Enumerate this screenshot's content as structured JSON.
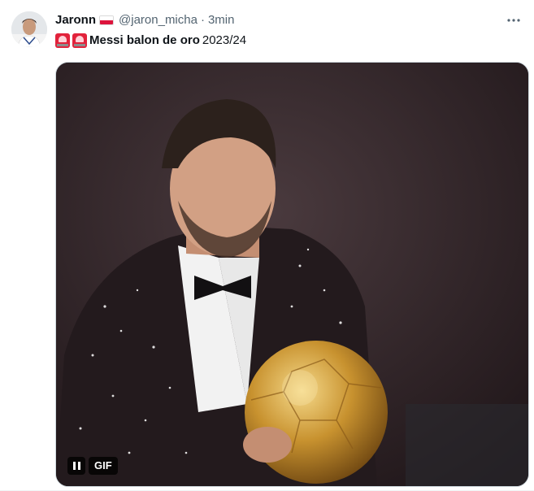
{
  "tweet": {
    "author": {
      "display_name": "Jaronn",
      "flag_icon": "poland-flag-icon",
      "handle": "@jaron_micha",
      "separator": "·",
      "time": "3min"
    },
    "more_icon": "more-horizontal-icon",
    "text": {
      "emoji_icon": "police-light-icon",
      "bold": "Messi balon de oro",
      "rest": "2023/24"
    },
    "media": {
      "badge": "GIF",
      "pause_icon": "pause-icon"
    }
  },
  "colors": {
    "text_primary": "#0f1419",
    "text_secondary": "#536471",
    "media_border": "#cfd9de"
  }
}
